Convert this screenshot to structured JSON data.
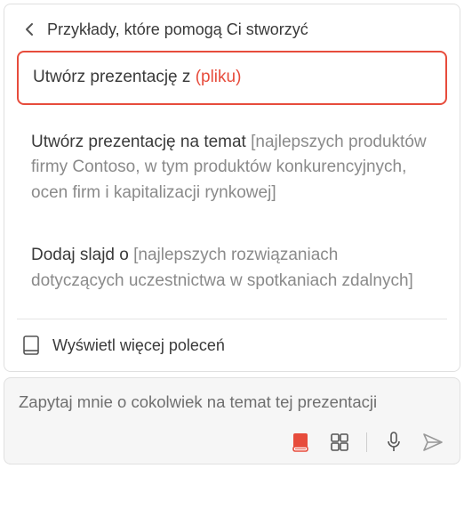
{
  "header": {
    "title": "Przykłady, które pomogą Ci stworzyć"
  },
  "suggestions": [
    {
      "main": "Utwórz prezentację z ",
      "param": "(pliku)",
      "placeholder": ""
    },
    {
      "main": "Utwórz prezentację na temat ",
      "param": "",
      "placeholder": "[najlepszych produktów firmy Contoso, w tym produktów konkurencyjnych, ocen firm i kapitalizacji rynkowej]"
    },
    {
      "main": "Dodaj slajd o ",
      "param": "",
      "placeholder": "[najlepszych rozwiązaniach dotyczących uczestnictwa w spotkaniach zdalnych]"
    }
  ],
  "more_label": "Wyświetl więcej poleceń",
  "input": {
    "placeholder": "Zapytaj mnie o cokolwiek na temat tej prezentacji"
  },
  "colors": {
    "accent": "#e74c3c"
  }
}
